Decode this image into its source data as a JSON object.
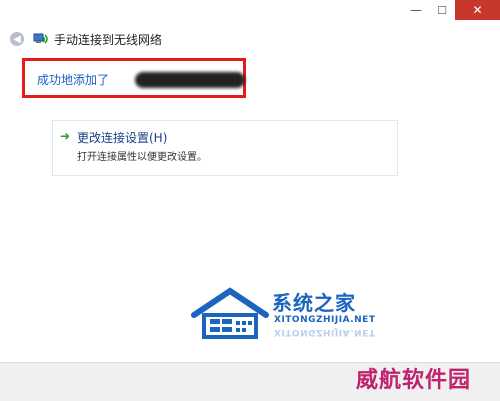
{
  "window": {
    "controls": {
      "minimize": "—",
      "maximize": "☐",
      "close": "✕"
    }
  },
  "header": {
    "back_icon": "back-arrow-icon",
    "network_icon": "wireless-network-icon",
    "title": "手动连接到无线网络"
  },
  "result": {
    "message": "成功地添加了"
  },
  "option": {
    "icon": "green-arrow-icon",
    "arrow_glyph": "➜",
    "title": "更改连接设置(H)",
    "description": "打开连接属性以便更改设置。"
  },
  "watermarks": {
    "site_name": "系统之家",
    "site_url": "XITONGZHIJIA.NET",
    "corner_text": "威航软件园"
  },
  "colors": {
    "close_button": "#c7372e",
    "highlight_border": "#e21c1c",
    "link_blue": "#1b3f8b",
    "watermark_blue": "#1b64c0",
    "corner_watermark": "#c02270"
  }
}
